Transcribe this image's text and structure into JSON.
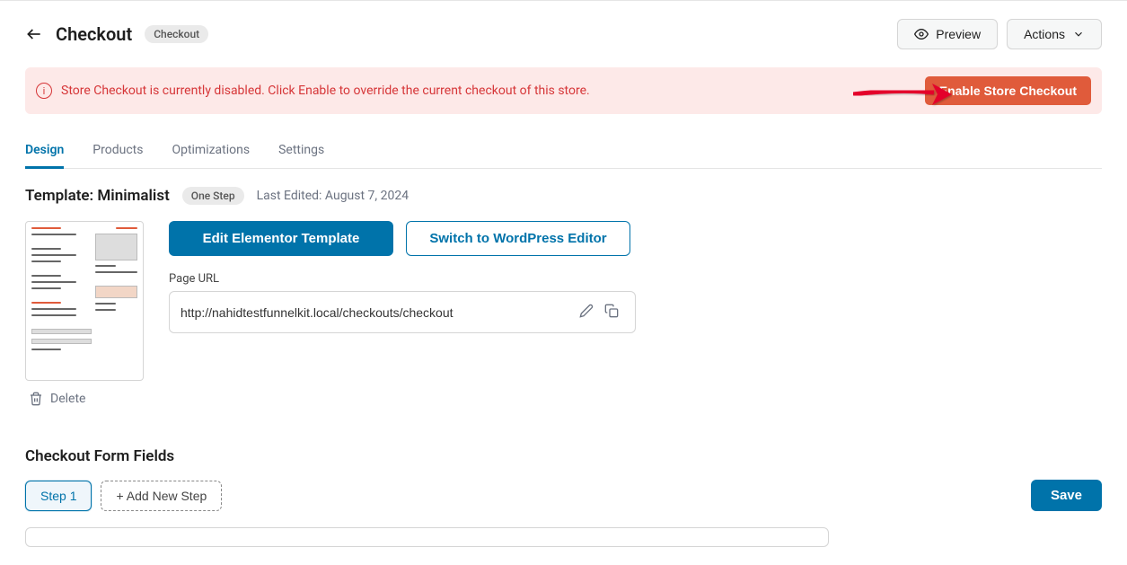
{
  "header": {
    "title": "Checkout",
    "badge": "Checkout",
    "preview_label": "Preview",
    "actions_label": "Actions"
  },
  "notice": {
    "text": "Store Checkout is currently disabled. Click Enable to override the current checkout of this store.",
    "button": "Enable Store Checkout"
  },
  "tabs": {
    "design": "Design",
    "products": "Products",
    "optimizations": "Optimizations",
    "settings": "Settings"
  },
  "template": {
    "title": "Template: Minimalist",
    "step_badge": "One Step",
    "last_edited": "Last Edited: August 7, 2024",
    "delete_label": "Delete",
    "edit_button": "Edit Elementor Template",
    "switch_button": "Switch to WordPress Editor",
    "url_label": "Page URL",
    "url_value": "http://nahidtestfunnelkit.local/checkouts/checkout"
  },
  "form": {
    "section_title": "Checkout Form Fields",
    "step1_label": "Step 1",
    "add_step_label": "+ Add New Step",
    "save_label": "Save"
  }
}
